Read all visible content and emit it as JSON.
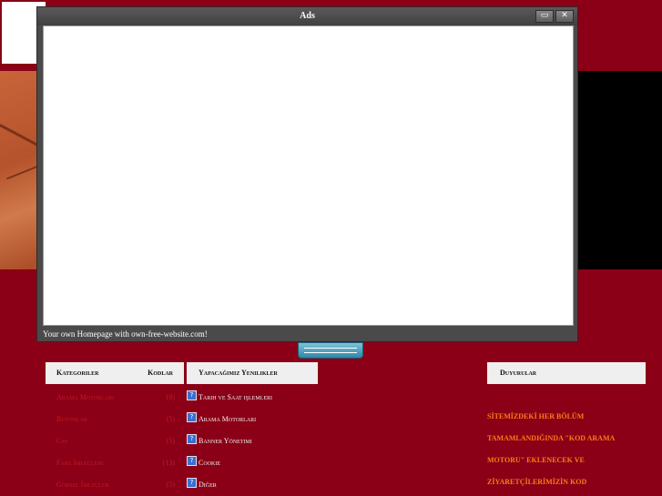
{
  "ads_popup": {
    "title": "Ads",
    "footer_text": "Your own Homepage with own-free-website.com!",
    "restore_glyph": "▭",
    "close_glyph": "✕"
  },
  "categories": {
    "header_label": "Kategoriler",
    "header_count_label": "Kodlar",
    "items": [
      {
        "label": "Arama Motorları",
        "count": "(8)"
      },
      {
        "label": "Butonlar",
        "count": "(5)"
      },
      {
        "label": "Css",
        "count": "(5)"
      },
      {
        "label": "Fare İmleçleri",
        "count": "(13)"
      },
      {
        "label": "Görsel İmleçler",
        "count": "(5)"
      }
    ]
  },
  "upcoming": {
    "header_label": "Yapacağımız Yenilikler",
    "icon_glyph": "?",
    "items": [
      {
        "label": "Tarih ve Saat işlemleri"
      },
      {
        "label": "Arama Motorları"
      },
      {
        "label": "Banner Yönetimi"
      },
      {
        "label": "Cookie"
      },
      {
        "label": "Diğer"
      }
    ]
  },
  "announcements": {
    "header_label": "Duyurular",
    "text": "SİTEMİZDEKİ HER BÖLÜM\nTAMAMLANDIĞINDA \"KOD ARAMA\nMOTORU\" EKLENECEK VE\nZİYARETÇİLERİMİZİN KOD"
  },
  "colors": {
    "page_background": "#8b0016",
    "category_link": "#c01a28",
    "announcement_text": "#ff7a1a",
    "question_icon": "#3a6fd0"
  }
}
